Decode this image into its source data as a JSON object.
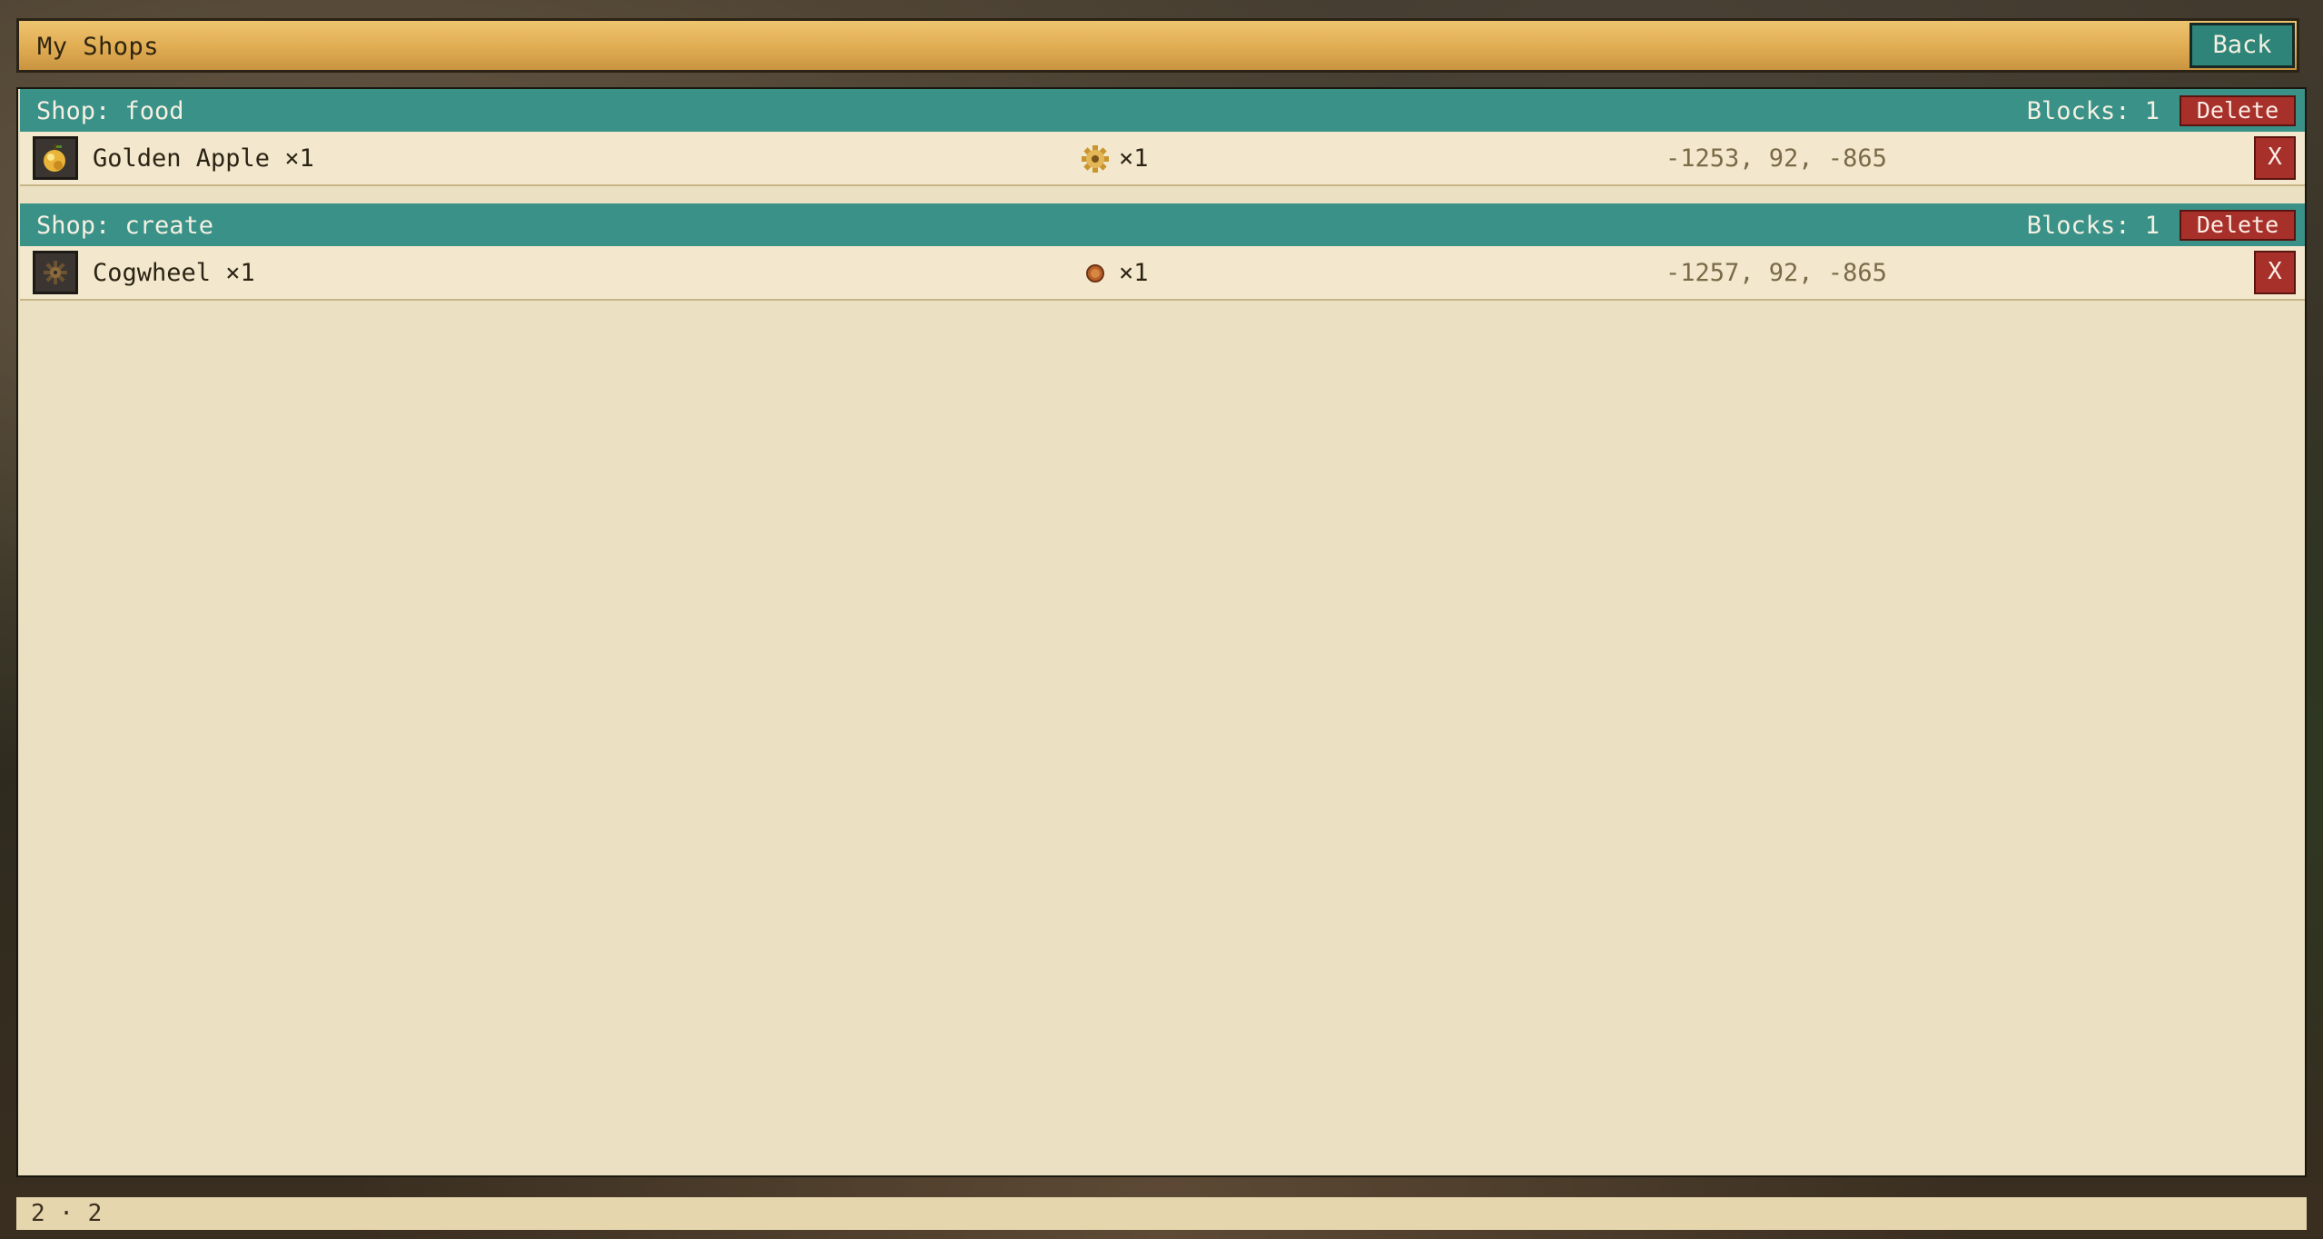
{
  "window": {
    "title": "My Shops",
    "back_label": "Back"
  },
  "shops": [
    {
      "title": "Shop: food",
      "blocks": "Blocks: 1",
      "delete_label": "Delete",
      "item": {
        "icon": "golden-apple-icon",
        "name": "Golden Apple ×1",
        "price_icon": "gold-gear-icon",
        "price_qty": "×1",
        "coords": "-1253, 92, -865",
        "remove_label": "X"
      }
    },
    {
      "title": "Shop: create",
      "blocks": "Blocks: 1",
      "delete_label": "Delete",
      "item": {
        "icon": "cogwheel-icon",
        "name": "Cogwheel ×1",
        "price_icon": "copper-coin-icon",
        "price_qty": "×1",
        "coords": "-1257, 92, -865",
        "remove_label": "X"
      }
    }
  ],
  "footer": {
    "page_indicator": "2 · 2"
  },
  "colors": {
    "title_bar": "#e0ac52",
    "shop_header": "#3a9188",
    "delete": "#a8302b",
    "panel": "#ebe0c2",
    "row": "#f3e8cd"
  }
}
